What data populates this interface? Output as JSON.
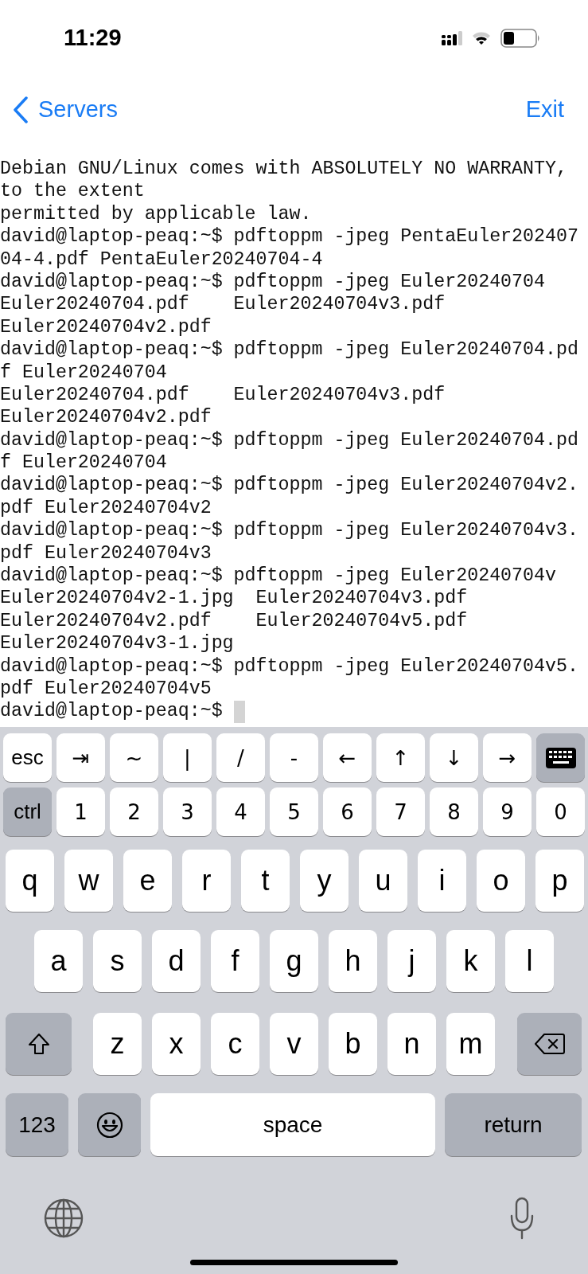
{
  "status_bar": {
    "time": "11:29"
  },
  "nav": {
    "back": "Servers",
    "exit": "Exit"
  },
  "terminal": {
    "lines": [
      "Debian GNU/Linux comes with ABSOLUTELY NO WARRANTY,",
      "to the extent",
      "permitted by applicable law.",
      "david@laptop-peaq:~$ pdftoppm -jpeg PentaEuler202407",
      "04-4.pdf PentaEuler20240704-4",
      "david@laptop-peaq:~$ pdftoppm -jpeg Euler20240704",
      "Euler20240704.pdf    Euler20240704v3.pdf",
      "Euler20240704v2.pdf",
      "david@laptop-peaq:~$ pdftoppm -jpeg Euler20240704.pd",
      "f Euler20240704",
      "Euler20240704.pdf    Euler20240704v3.pdf",
      "Euler20240704v2.pdf",
      "david@laptop-peaq:~$ pdftoppm -jpeg Euler20240704.pd",
      "f Euler20240704",
      "david@laptop-peaq:~$ pdftoppm -jpeg Euler20240704v2.",
      "pdf Euler20240704v2",
      "david@laptop-peaq:~$ pdftoppm -jpeg Euler20240704v3.",
      "pdf Euler20240704v3",
      "david@laptop-peaq:~$ pdftoppm -jpeg Euler20240704v",
      "Euler20240704v2-1.jpg  Euler20240704v3.pdf",
      "Euler20240704v2.pdf    Euler20240704v5.pdf",
      "Euler20240704v3-1.jpg",
      "david@laptop-peaq:~$ pdftoppm -jpeg Euler20240704v5.",
      "pdf Euler20240704v5",
      "david@laptop-peaq:~$"
    ]
  },
  "keyboard": {
    "toolbar": [
      "esc",
      "⇥",
      "~",
      "|",
      "/",
      "-",
      "←",
      "↑",
      "↓",
      "→"
    ],
    "number_row": [
      {
        "label": "ctrl",
        "kind": "modifier"
      },
      {
        "label": "1",
        "kind": "key"
      },
      {
        "label": "2",
        "kind": "key"
      },
      {
        "label": "3",
        "kind": "key"
      },
      {
        "label": "4",
        "kind": "key"
      },
      {
        "label": "5",
        "kind": "key"
      },
      {
        "label": "6",
        "kind": "key"
      },
      {
        "label": "7",
        "kind": "key"
      },
      {
        "label": "8",
        "kind": "key"
      },
      {
        "label": "9",
        "kind": "key"
      },
      {
        "label": "0",
        "kind": "key"
      }
    ],
    "letter_rows": [
      [
        "q",
        "w",
        "e",
        "r",
        "t",
        "y",
        "u",
        "i",
        "o",
        "p"
      ],
      [
        "a",
        "s",
        "d",
        "f",
        "g",
        "h",
        "j",
        "k",
        "l"
      ],
      [
        "z",
        "x",
        "c",
        "v",
        "b",
        "n",
        "m"
      ]
    ],
    "bottom": {
      "numbers": "123",
      "space": "space",
      "return": "return"
    }
  }
}
